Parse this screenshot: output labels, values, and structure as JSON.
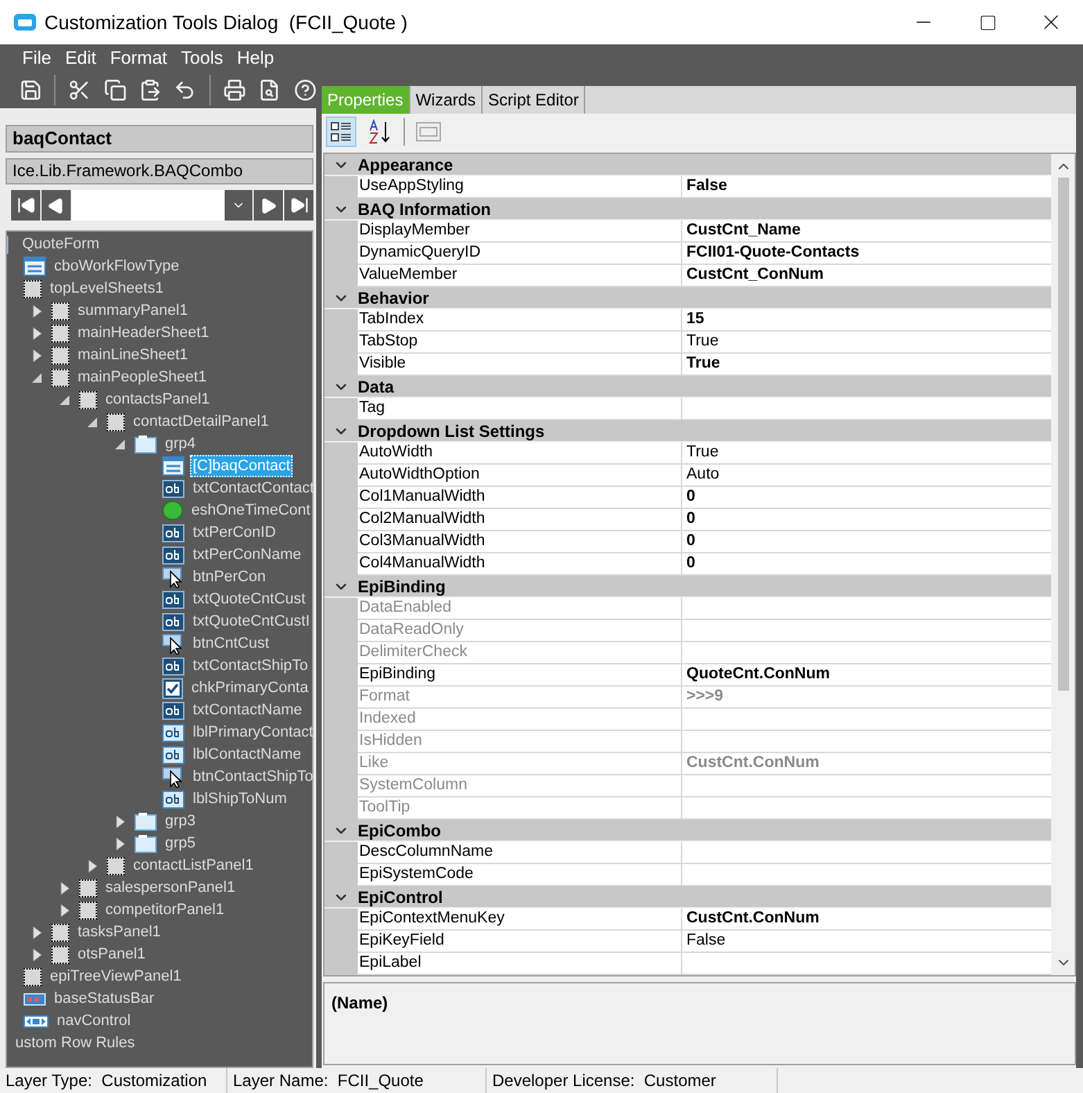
{
  "window": {
    "title": "Customization Tools Dialog  (FCII_Quote )"
  },
  "menu": [
    "File",
    "Edit",
    "Format",
    "Tools",
    "Help"
  ],
  "toolbar": [
    {
      "kind": "save"
    },
    {
      "kind": "sep"
    },
    {
      "kind": "cut"
    },
    {
      "kind": "copy"
    },
    {
      "kind": "paste"
    },
    {
      "kind": "undo"
    },
    {
      "kind": "sep"
    },
    {
      "kind": "print"
    },
    {
      "kind": "preview"
    },
    {
      "kind": "help"
    }
  ],
  "control": {
    "name": "baqContact",
    "type": "Ice.Lib.Framework.BAQCombo"
  },
  "tree": [
    {
      "label": "QuoteForm",
      "kind": "form",
      "selected": false
    },
    {
      "label": "cboWorkFlowType",
      "kind": "combo",
      "selected": false
    },
    {
      "label": "topLevelSheets1",
      "kind": "panel",
      "selected": false,
      "children": [
        {
          "label": "summaryPanel1",
          "kind": "panel",
          "selected": false,
          "expanded": false
        },
        {
          "label": "mainHeaderSheet1",
          "kind": "panel",
          "selected": false,
          "expanded": false
        },
        {
          "label": "mainLineSheet1",
          "kind": "panel",
          "selected": false,
          "expanded": false
        },
        {
          "label": "mainPeopleSheet1",
          "kind": "panel",
          "selected": false,
          "expanded": true,
          "children": [
            {
              "label": "contactsPanel1",
              "kind": "panel",
              "selected": false,
              "expanded": true,
              "children": [
                {
                  "label": "contactDetailPanel1",
                  "kind": "panel",
                  "selected": false,
                  "expanded": true,
                  "children": [
                    {
                      "label": "grp4",
                      "kind": "group",
                      "selected": false,
                      "expanded": true,
                      "children": [
                        {
                          "label": "[C]baqContact",
                          "kind": "combo",
                          "selected": true
                        },
                        {
                          "label": "txtContactContact",
                          "kind": "textbox",
                          "selected": false
                        },
                        {
                          "label": "eshOneTimeCont",
                          "kind": "shape",
                          "selected": false
                        },
                        {
                          "label": "txtPerConID",
                          "kind": "textbox",
                          "selected": false
                        },
                        {
                          "label": "txtPerConName",
                          "kind": "textbox",
                          "selected": false
                        },
                        {
                          "label": "btnPerCon",
                          "kind": "button",
                          "selected": false
                        },
                        {
                          "label": "txtQuoteCntCust",
                          "kind": "textbox",
                          "selected": false
                        },
                        {
                          "label": "txtQuoteCntCustI",
                          "kind": "textbox",
                          "selected": false
                        },
                        {
                          "label": "btnCntCust",
                          "kind": "button",
                          "selected": false
                        },
                        {
                          "label": "txtContactShipTo",
                          "kind": "textbox",
                          "selected": false
                        },
                        {
                          "label": "chkPrimaryConta",
                          "kind": "checkbox",
                          "selected": false
                        },
                        {
                          "label": "txtContactName",
                          "kind": "textbox",
                          "selected": false
                        },
                        {
                          "label": "lblPrimaryContact",
                          "kind": "label",
                          "selected": false
                        },
                        {
                          "label": "lblContactName",
                          "kind": "label",
                          "selected": false
                        },
                        {
                          "label": "btnContactShipTo",
                          "kind": "button",
                          "selected": false
                        },
                        {
                          "label": "lblShipToNum",
                          "kind": "label",
                          "selected": false
                        }
                      ]
                    },
                    {
                      "label": "grp3",
                      "kind": "group",
                      "selected": false,
                      "expanded": false
                    },
                    {
                      "label": "grp5",
                      "kind": "group",
                      "selected": false,
                      "expanded": false
                    }
                  ]
                },
                {
                  "label": "contactListPanel1",
                  "kind": "panel",
                  "selected": false,
                  "expanded": false
                }
              ]
            },
            {
              "label": "salespersonPanel1",
              "kind": "panel",
              "selected": false,
              "expanded": false
            },
            {
              "label": "competitorPanel1",
              "kind": "panel",
              "selected": false,
              "expanded": false
            }
          ]
        },
        {
          "label": "tasksPanel1",
          "kind": "panel",
          "selected": false,
          "expanded": false
        },
        {
          "label": "otsPanel1",
          "kind": "panel",
          "selected": false,
          "expanded": false
        }
      ]
    },
    {
      "label": "epiTreeViewPanel1",
      "kind": "panel",
      "selected": false
    },
    {
      "label": "baseStatusBar",
      "kind": "statusbar",
      "selected": false
    },
    {
      "label": "navControl",
      "kind": "navcontrol",
      "selected": false
    },
    {
      "label": "ustom Row Rules",
      "kind": "text",
      "selected": false
    }
  ],
  "tabs": [
    {
      "label": "Properties",
      "selected": true
    },
    {
      "label": "Wizards",
      "selected": false
    },
    {
      "label": "Script Editor",
      "selected": false
    }
  ],
  "grid_toolbar": [
    {
      "kind": "categorized",
      "selected": true
    },
    {
      "kind": "alphabetical",
      "selected": false
    },
    {
      "kind": "pages",
      "selected": false
    }
  ],
  "categories": [
    {
      "name": "Appearance",
      "expanded": true,
      "rows": [
        {
          "name": "UseAppStyling",
          "value": "False",
          "modified": true,
          "disabled": false
        }
      ]
    },
    {
      "name": "BAQ Information",
      "expanded": true,
      "rows": [
        {
          "name": "DisplayMember",
          "value": "CustCnt_Name",
          "modified": true,
          "disabled": false
        },
        {
          "name": "DynamicQueryID",
          "value": "FCII01-Quote-Contacts",
          "modified": true,
          "disabled": false
        },
        {
          "name": "ValueMember",
          "value": "CustCnt_ConNum",
          "modified": true,
          "disabled": false
        }
      ]
    },
    {
      "name": "Behavior",
      "expanded": true,
      "rows": [
        {
          "name": "TabIndex",
          "value": "15",
          "modified": true,
          "disabled": false
        },
        {
          "name": "TabStop",
          "value": "True",
          "modified": false,
          "disabled": false
        },
        {
          "name": "Visible",
          "value": "True",
          "modified": true,
          "disabled": false
        }
      ]
    },
    {
      "name": "Data",
      "expanded": true,
      "rows": [
        {
          "name": "Tag",
          "disabled": false
        }
      ]
    },
    {
      "name": "Dropdown List Settings",
      "expanded": true,
      "rows": [
        {
          "name": "AutoWidth",
          "value": "True",
          "modified": false,
          "disabled": false
        },
        {
          "name": "AutoWidthOption",
          "value": "Auto",
          "modified": false,
          "disabled": false
        },
        {
          "name": "Col1ManualWidth",
          "value": "0",
          "modified": true,
          "disabled": false
        },
        {
          "name": "Col2ManualWidth",
          "value": "0",
          "modified": true,
          "disabled": false
        },
        {
          "name": "Col3ManualWidth",
          "value": "0",
          "modified": true,
          "disabled": false
        },
        {
          "name": "Col4ManualWidth",
          "value": "0",
          "modified": true,
          "disabled": false
        }
      ]
    },
    {
      "name": "EpiBinding",
      "expanded": true,
      "rows": [
        {
          "name": "DataEnabled",
          "disabled": true
        },
        {
          "name": "DataReadOnly",
          "disabled": true
        },
        {
          "name": "DelimiterCheck",
          "disabled": true
        },
        {
          "name": "EpiBinding",
          "value": "QuoteCnt.ConNum",
          "modified": true,
          "disabled": false
        },
        {
          "name": "Format",
          "value": ">>>9",
          "modified": true,
          "disabled": true
        },
        {
          "name": "Indexed",
          "disabled": true
        },
        {
          "name": "IsHidden",
          "disabled": true
        },
        {
          "name": "Like",
          "value": "CustCnt.ConNum",
          "modified": true,
          "disabled": true
        },
        {
          "name": "SystemColumn",
          "disabled": true
        },
        {
          "name": "ToolTip",
          "disabled": true
        }
      ]
    },
    {
      "name": "EpiCombo",
      "expanded": true,
      "rows": [
        {
          "name": "DescColumnName",
          "disabled": false
        },
        {
          "name": "EpiSystemCode",
          "disabled": false
        }
      ]
    },
    {
      "name": "EpiControl",
      "expanded": true,
      "rows": [
        {
          "name": "EpiContextMenuKey",
          "value": "CustCnt.ConNum",
          "modified": true,
          "disabled": false
        },
        {
          "name": "EpiKeyField",
          "value": "False",
          "modified": false,
          "disabled": false
        },
        {
          "name": "EpiLabel",
          "disabled": false
        }
      ]
    }
  ],
  "description": {
    "title": "(Name)"
  },
  "status_bar": [
    {
      "label": "Layer Type:  Customization"
    },
    {
      "label": "Layer Name:  FCII_Quote"
    },
    {
      "label": "Developer License:  Customer"
    }
  ]
}
